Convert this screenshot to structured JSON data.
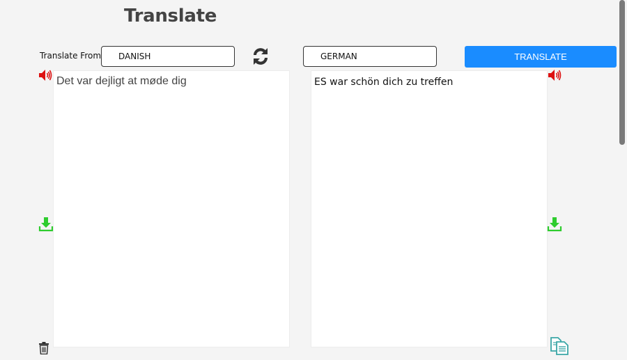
{
  "header": {
    "title": "Translate"
  },
  "controls": {
    "from_label": "Translate From",
    "source_language": "DANISH",
    "target_language": "GERMAN",
    "translate_label": "TRANSLATE"
  },
  "source": {
    "text": "Det var dejligt at møde dig"
  },
  "target": {
    "text": "ES war schön dich zu treffen"
  },
  "icons": {
    "speaker": "speaker-icon",
    "download": "download-icon",
    "trash": "trash-icon",
    "copy": "copy-icon",
    "swap": "swap-icon"
  },
  "colors": {
    "accent": "#1a8cff",
    "speaker": "#dd1111",
    "download": "#2ecc2e",
    "copy": "#3aa6a6",
    "title": "#444444"
  }
}
